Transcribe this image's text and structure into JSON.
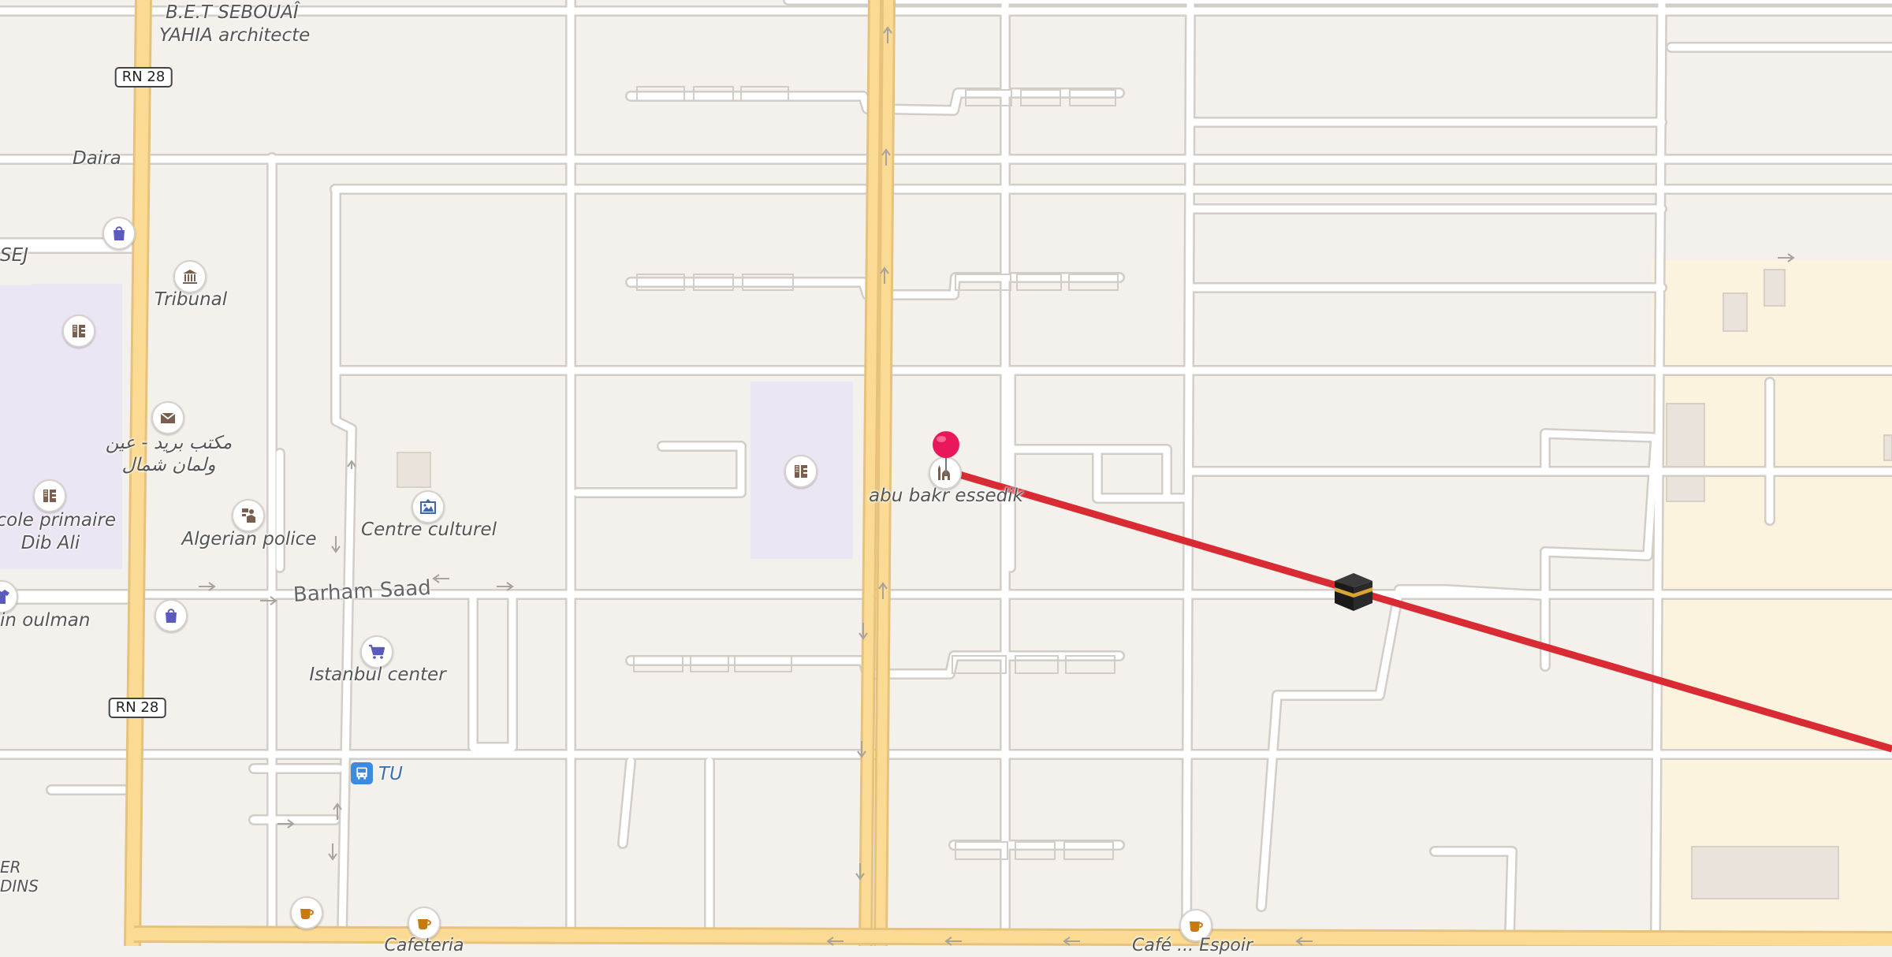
{
  "colors": {
    "background": "#f4f1ec",
    "road_main": "#fbdb94",
    "road_main_casing": "#e7c27c",
    "road_minor": "#ffffff",
    "road_minor_casing": "#d2cdc7",
    "education_area": "#ece6f4",
    "yellow_area": "#fbf3dd",
    "building": "#e9e3dc",
    "route_line": "#d92b34",
    "pin": "#e8185a"
  },
  "labels": {
    "bet": "B.E.T SEBOUAÎ",
    "architect": "YAHIA architecte",
    "daira": "Daira",
    "sej": "SEJ",
    "tribunal": "Tribunal",
    "post_ar_1": "مكتب بريد - عين",
    "post_ar_2": "ولمان شمال",
    "ecole_1": "Ecole primaire",
    "ecole_2": "Dib Ali",
    "algerian_police": "Algerian police",
    "centre_culturel": "Centre culturel",
    "abu_bakr": "abu bakr essedik",
    "ain_oulman": "in oulman",
    "istanbul": "Istanbul center",
    "tu": "TU",
    "ter": "ER",
    "dins": "DINS",
    "cafeteria": "Cafeteria",
    "cafe_bottom": "Café ... Espoir"
  },
  "streets": {
    "barham_saad": "Barham Saad"
  },
  "shields": {
    "rn28_top": "RN 28",
    "rn28_bottom": "RN 28"
  },
  "icons": {
    "shop": "shopping-bag-icon",
    "courthouse": "courthouse-icon",
    "school": "school-icon",
    "post": "envelope-icon",
    "police": "police-icon",
    "culture": "art-gallery-icon",
    "mosque": "mosque-icon",
    "supermarket": "shopping-cart-icon",
    "cafe": "coffee-cup-icon",
    "bus": "bus-icon",
    "destination": "kaaba-icon",
    "location": "location-pin-icon"
  }
}
